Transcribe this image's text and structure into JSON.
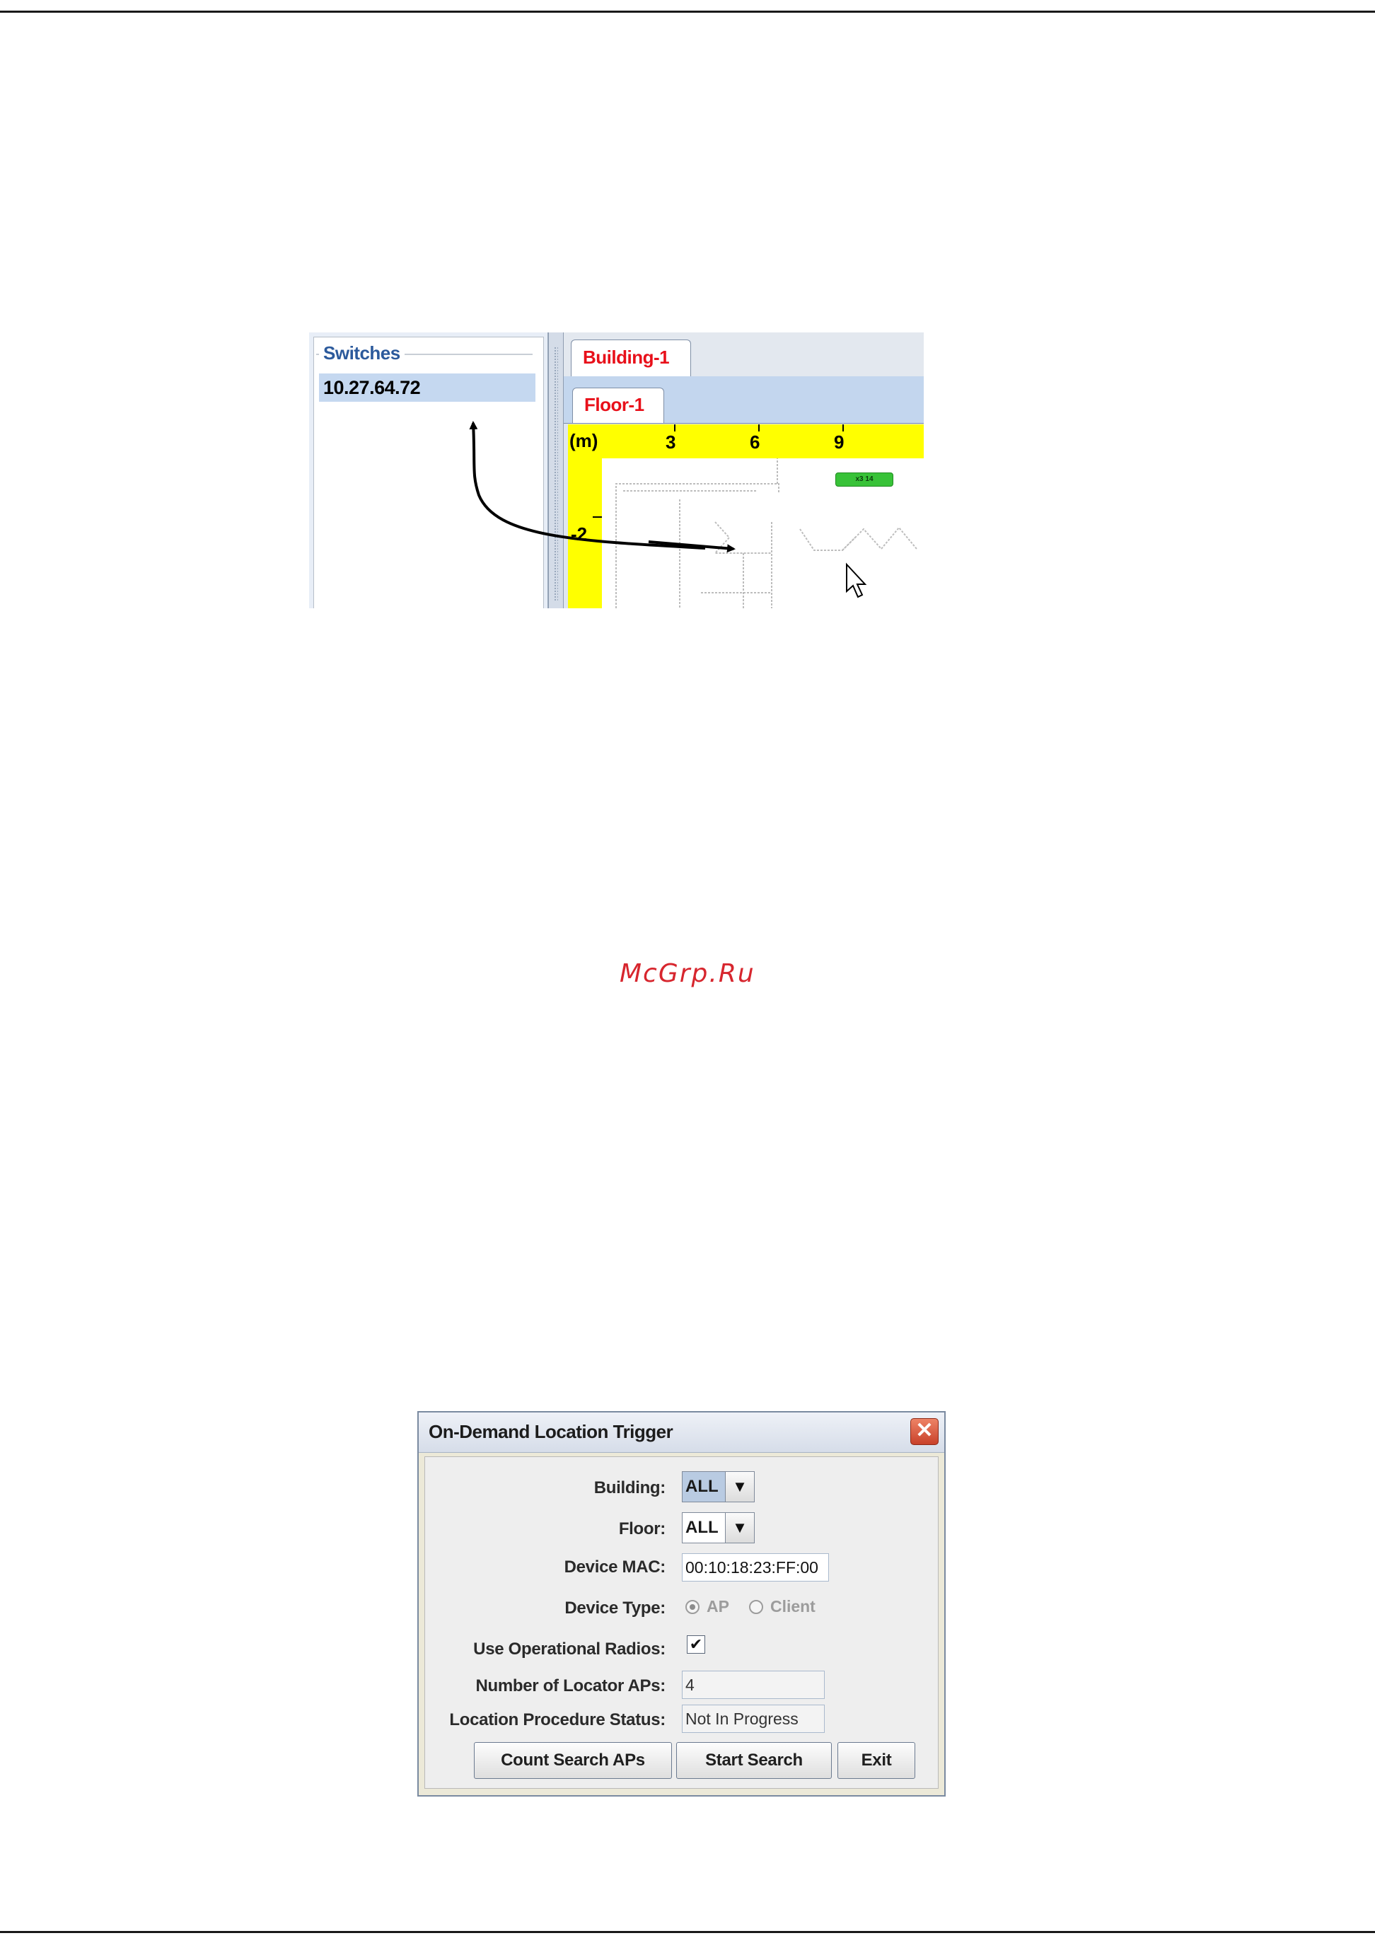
{
  "switches_panel": {
    "title": "Switches",
    "items": [
      "10.27.64.72"
    ]
  },
  "map_view": {
    "building_tab": "Building-1",
    "floor_tab": "Floor-1",
    "ruler_unit": "(m)",
    "ruler_top_ticks": [
      "3",
      "6",
      "9"
    ],
    "ruler_left_ticks": [
      "-2"
    ],
    "ap_badge": "x3 14"
  },
  "watermark": "McGrp.Ru",
  "dialog": {
    "title": "On-Demand Location Trigger",
    "close_glyph": "✕",
    "building_label": "Building:",
    "building_value": "ALL",
    "floor_label": "Floor:",
    "floor_value": "ALL",
    "device_mac_label": "Device MAC:",
    "device_mac_value": "00:10:18:23:FF:00",
    "device_type_label": "Device Type:",
    "device_type_options": [
      "AP",
      "Client"
    ],
    "device_type_selected": "AP",
    "use_radios_label": "Use Operational Radios:",
    "use_radios_checked": true,
    "use_radios_glyph": "✔",
    "num_locator_label": "Number of Locator APs:",
    "num_locator_value": "4",
    "status_label": "Location Procedure Status:",
    "status_value": "Not In Progress",
    "buttons": {
      "count": "Count Search APs",
      "start": "Start Search",
      "exit": "Exit"
    },
    "arrow_glyph": "▼"
  },
  "colors": {
    "tab_text": "#e8101a",
    "ruler": "#ffff00",
    "selection": "#c5d8f0",
    "watermark": "#d7262e"
  }
}
